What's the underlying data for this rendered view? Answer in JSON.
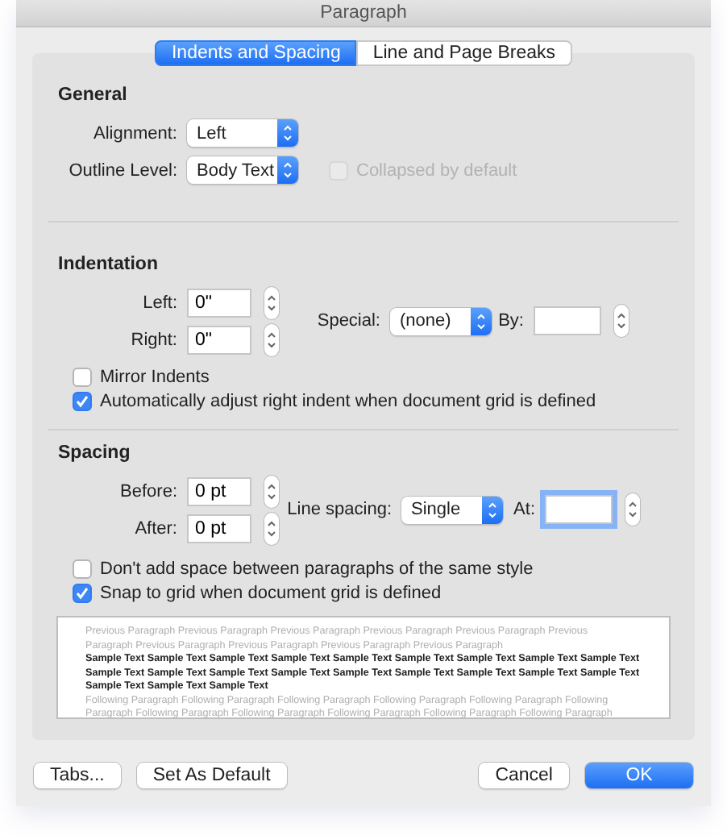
{
  "window": {
    "title": "Paragraph"
  },
  "tabs": [
    {
      "label": "Indents and Spacing",
      "selected": true
    },
    {
      "label": "Line and Page Breaks",
      "selected": false
    }
  ],
  "general": {
    "heading": "General",
    "alignment": {
      "label": "Alignment:",
      "value": "Left"
    },
    "outline_level": {
      "label": "Outline Level:",
      "value": "Body Text"
    },
    "collapsed": {
      "label": "Collapsed by default",
      "checked": false,
      "disabled": true
    }
  },
  "indentation": {
    "heading": "Indentation",
    "left": {
      "label": "Left:",
      "value": "0\""
    },
    "right": {
      "label": "Right:",
      "value": "0\""
    },
    "special": {
      "label": "Special:",
      "value": "(none)"
    },
    "by": {
      "label": "By:"
    },
    "checkboxes": [
      {
        "label": "Mirror Indents",
        "checked": false
      },
      {
        "label": "Automatically adjust right indent when document grid is defined",
        "checked": true
      }
    ]
  },
  "spacing": {
    "heading": "Spacing",
    "before": {
      "label": "Before:",
      "value": "0 pt"
    },
    "after": {
      "label": "After:",
      "value": "0 pt"
    },
    "line_spacing": {
      "label": "Line spacing:",
      "value": "Single"
    },
    "at": {
      "label": "At:",
      "focused": true
    },
    "checkboxes": [
      {
        "label": "Don't add space between paragraphs of the same style",
        "checked": false
      },
      {
        "label": "Snap to grid when document grid is defined",
        "checked": true
      }
    ]
  },
  "preview": {
    "previous": [
      "Previous Paragraph Previous Paragraph Previous Paragraph Previous Paragraph Previous Paragraph Previous",
      "Paragraph Previous Paragraph Previous Paragraph Previous Paragraph Previous Paragraph"
    ],
    "sample": [
      "Sample Text Sample Text Sample Text Sample Text Sample Text Sample Text Sample Text Sample Text Sample Text",
      "Sample Text Sample Text Sample Text Sample Text Sample Text Sample Text Sample Text Sample Text Sample Text",
      "Sample Text Sample Text Sample Text"
    ],
    "following": [
      "Following Paragraph Following Paragraph Following Paragraph Following Paragraph Following Paragraph Following",
      "Paragraph Following Paragraph Following Paragraph Following Paragraph Following Paragraph Following Paragraph"
    ]
  },
  "left_buttons": [
    {
      "label": "Tabs...",
      "primary": false
    },
    {
      "label": "Set As Default",
      "primary": false
    }
  ],
  "right_buttons": [
    {
      "label": "Cancel",
      "primary": false
    },
    {
      "label": "OK",
      "primary": true
    }
  ]
}
